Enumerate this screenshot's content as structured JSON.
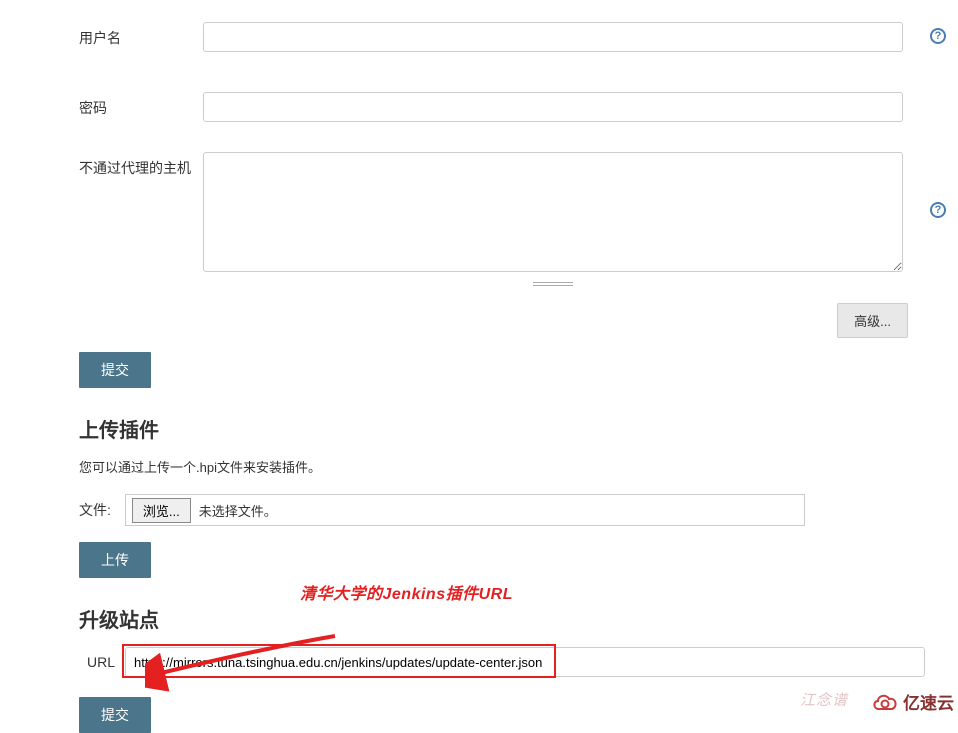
{
  "proxy": {
    "username_label": "用户名",
    "username_value": "",
    "password_label": "密码",
    "password_value": "",
    "noproxy_label": "不通过代理的主机",
    "noproxy_value": "",
    "advanced_label": "高级...",
    "submit_label": "提交"
  },
  "upload": {
    "heading": "上传插件",
    "hint": "您可以通过上传一个.hpi文件来安装插件。",
    "file_label": "文件:",
    "browse_label": "浏览...",
    "file_status": "未选择文件。",
    "upload_label": "上传"
  },
  "update_site": {
    "heading": "升级站点",
    "url_label": "URL",
    "url_value": "https://mirrors.tuna.tsinghua.edu.cn/jenkins/updates/update-center.json",
    "submit_label": "提交"
  },
  "annotation": "清华大学的Jenkins插件URL",
  "watermark": {
    "author": "江念谱",
    "brand": "亿速云"
  },
  "help_glyph": "?"
}
